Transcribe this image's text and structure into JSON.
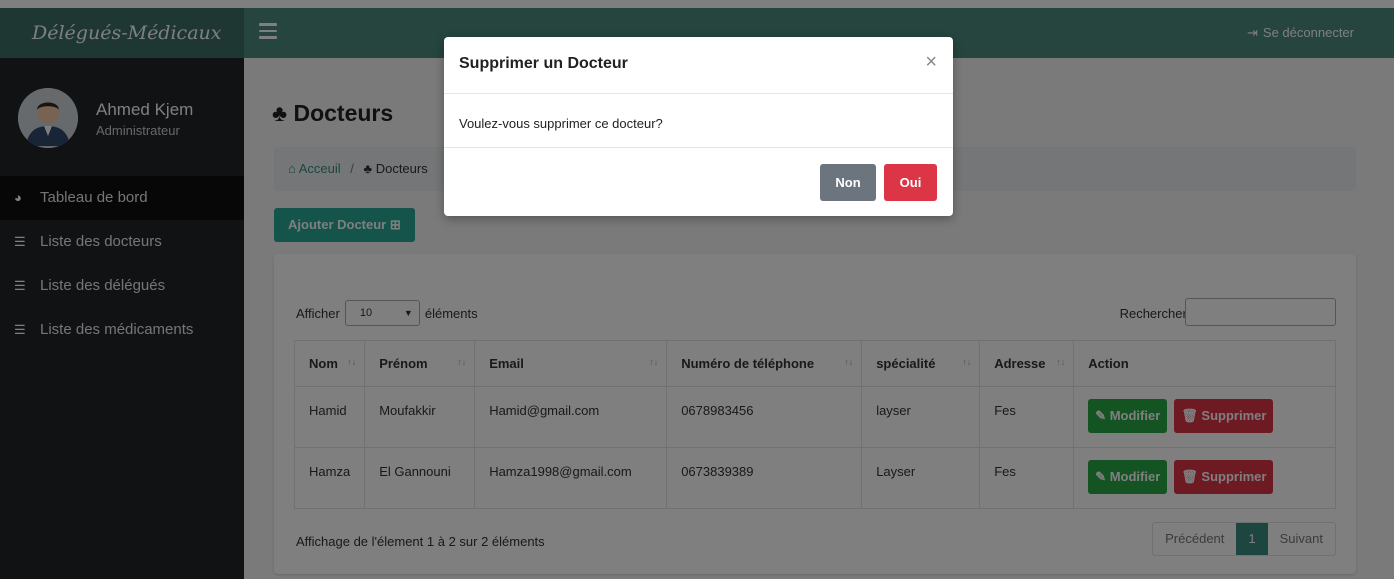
{
  "topbar": {
    "brand": "Délégués-Médicaux",
    "logout_label": "Se déconnecter",
    "logout_icon": "sign-out-icon",
    "menu_icon": "hamburger-icon"
  },
  "sidebar": {
    "user_name": "Ahmed Kjem",
    "user_role": "Administrateur",
    "items": [
      {
        "label": "Tableau de bord",
        "icon": "dashboard-icon"
      },
      {
        "label": "Liste des docteurs",
        "icon": "list-icon"
      },
      {
        "label": "Liste des délégués",
        "icon": "list-icon"
      },
      {
        "label": "Liste des médicaments",
        "icon": "list-icon"
      }
    ]
  },
  "main": {
    "title": "Docteurs",
    "breadcrumb": [
      "Acceuil",
      "Docteurs"
    ],
    "add_button": "Ajouter Docteur",
    "afficher_label": "Afficher",
    "page_size": "10",
    "elements_label": "éléments",
    "search_label": "Rechercher :",
    "search_value": "",
    "table": {
      "headers": [
        "Nom",
        "Prénom",
        "Email",
        "Numéro de téléphone",
        "spécialité",
        "Adresse",
        "Action"
      ],
      "rows": [
        [
          "Hamid",
          "Moufakkir",
          "Hamid@gmail.com",
          "0678983456",
          "layser",
          "Fes"
        ],
        [
          "Hamza",
          "El Gannouni",
          "Hamza1998@gmail.com",
          "0673839389",
          "Layser",
          "Fes"
        ]
      ],
      "modify_label": "Modifier",
      "delete_label": "Supprimer"
    },
    "info": "Affichage de l'élement 1 à 2 sur 2 éléments",
    "pager": {
      "prev": "Précédent",
      "current": "1",
      "next": "Suivant"
    }
  },
  "modal": {
    "title": "Supprimer un Docteur",
    "close": "×",
    "message": "Voulez-vous supprimer ce docteur?",
    "no_label": "Non",
    "yes_label": "Oui"
  },
  "colors": {
    "topbar": "#4a8a7d",
    "brand_bg": "#3c6f64",
    "sidebar": "#222426",
    "accent": "#28a995",
    "danger": "#dc3545",
    "success": "#28a745",
    "secondary": "#6c757d"
  }
}
